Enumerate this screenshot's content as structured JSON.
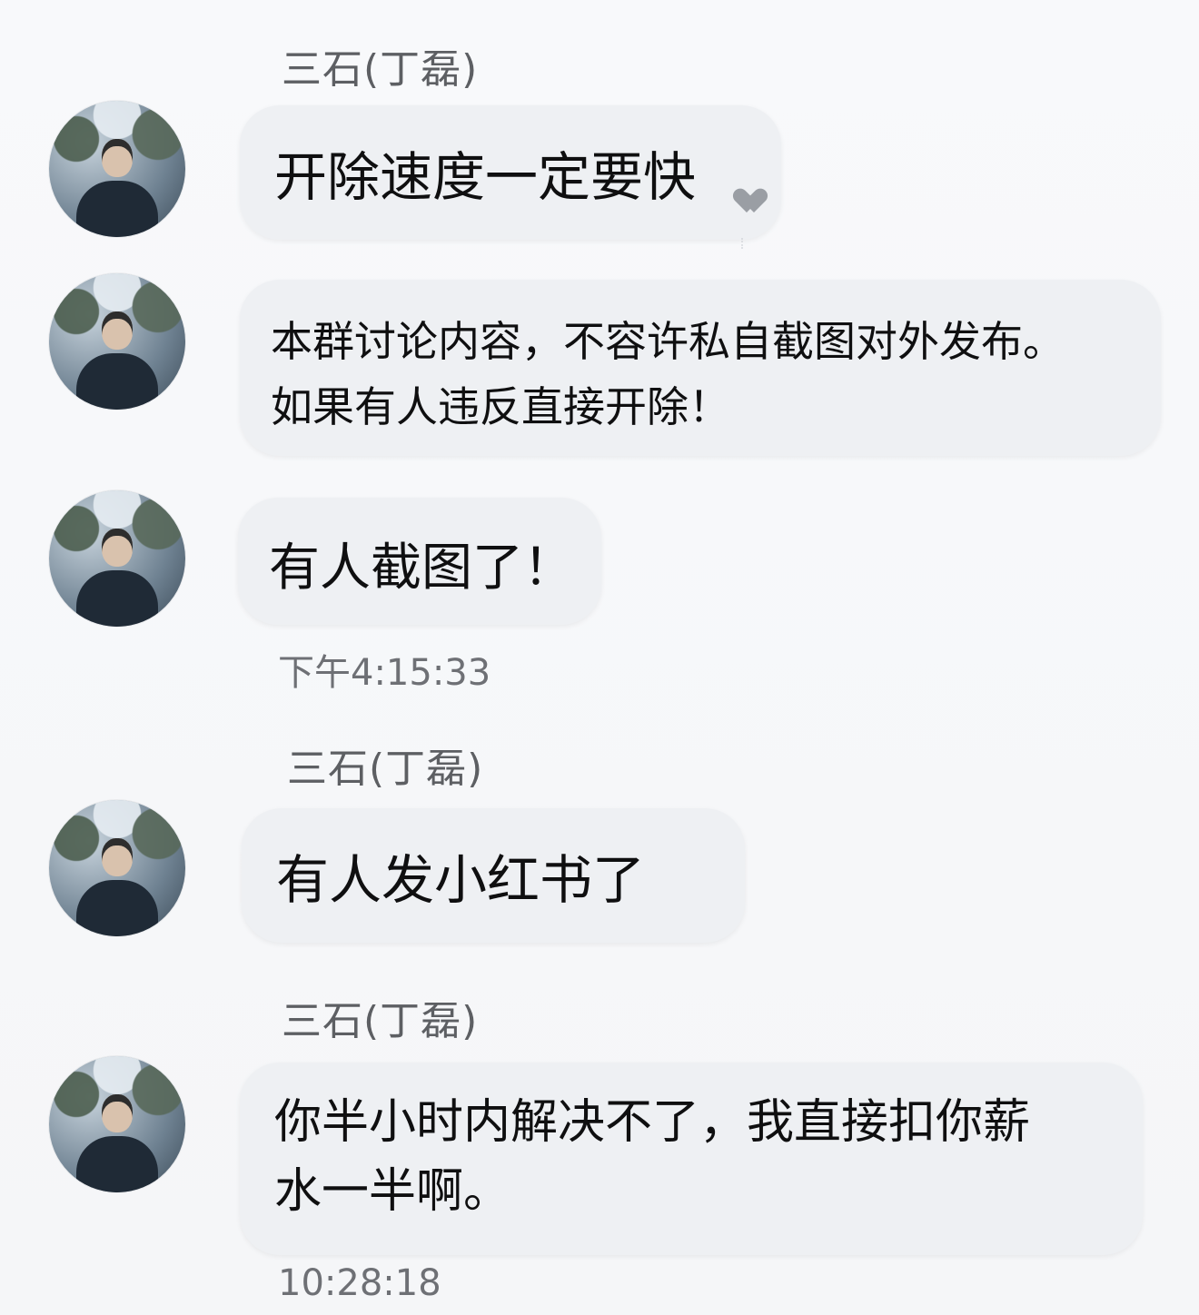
{
  "messages": [
    {
      "sender": "三石(丁磊)",
      "text": "开除速度一定要快"
    },
    {
      "sender": "",
      "text": "本群讨论内容，不容许私自截图对外发布。\n如果有人违反直接开除！"
    },
    {
      "sender": "",
      "text": "有人截图了！"
    },
    {
      "sender": "三石(丁磊)",
      "text": "有人发小红书了"
    },
    {
      "sender": "三石(丁磊)",
      "text": "你半小时内解决不了，我直接扣你薪\n水一半啊。"
    }
  ],
  "timestamps": [
    "下午4:15:33",
    "10:28:18"
  ],
  "colors": {
    "background": "#f7f8fa",
    "bubble": "#eef0f3",
    "sender": "#5d5f63",
    "timestamp": "#6e7075"
  },
  "icons": {
    "avatar": "profile-photo",
    "reaction": "heart-icon"
  }
}
